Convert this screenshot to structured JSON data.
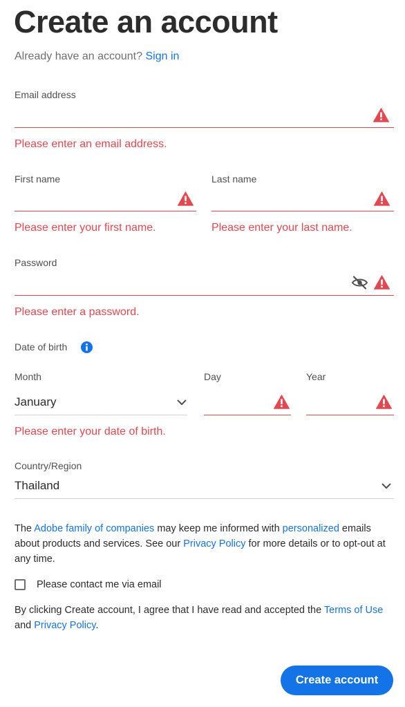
{
  "page": {
    "title": "Create an account",
    "signin_prompt": "Already have an account?",
    "signin_link": "Sign in"
  },
  "fields": {
    "email": {
      "label": "Email address",
      "value": "",
      "error": "Please enter an email address."
    },
    "first_name": {
      "label": "First name",
      "value": "",
      "error": "Please enter your first name."
    },
    "last_name": {
      "label": "Last name",
      "value": "",
      "error": "Please enter your last name."
    },
    "password": {
      "label": "Password",
      "value": "",
      "error": "Please enter a password."
    }
  },
  "dob": {
    "label": "Date of birth",
    "month_label": "Month",
    "month_value": "January",
    "day_label": "Day",
    "day_value": "",
    "year_label": "Year",
    "year_value": "",
    "error": "Please enter your date of birth."
  },
  "country": {
    "label": "Country/Region",
    "value": "Thailand"
  },
  "consent": {
    "part1": "The ",
    "link_family": "Adobe family of companies",
    "part2": " may keep me informed with ",
    "link_personalized": "personalized",
    "part3": " emails about products and services. See our ",
    "link_privacy": "Privacy Policy",
    "part4": " for more details or to opt-out at any time."
  },
  "contact_checkbox": {
    "label": "Please contact me via email",
    "checked": false
  },
  "terms": {
    "part1": "By clicking Create account, I agree that I have read and accepted the ",
    "link_terms": "Terms of Use",
    "part2": " and ",
    "link_privacy": "Privacy Policy",
    "part3": "."
  },
  "submit": {
    "label": "Create account"
  },
  "colors": {
    "accent": "#1473e6",
    "error": "#e34850",
    "text": "#2c2c2c"
  },
  "icons": {
    "warning": "alert-triangle-icon",
    "info": "info-icon",
    "eye_off": "eye-off-icon",
    "chevron": "chevron-down-icon"
  }
}
